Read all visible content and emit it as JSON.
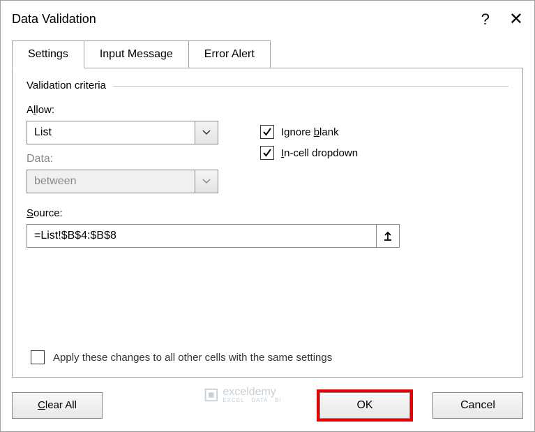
{
  "dialog": {
    "title": "Data Validation",
    "help": "?",
    "close": "✕"
  },
  "tabs": {
    "settings": "Settings",
    "input_message": "Input Message",
    "error_alert": "Error Alert"
  },
  "criteria": {
    "legend": "Validation criteria",
    "allow_label_pre": "A",
    "allow_label_u": "l",
    "allow_label_post": "low:",
    "allow_value": "List",
    "data_label": "Data:",
    "data_value": "between",
    "source_label_u": "S",
    "source_label_post": "ource:",
    "source_value": "=List!$B$4:$B$8"
  },
  "checks": {
    "ignore_blank_pre": "Ignore ",
    "ignore_blank_u": "b",
    "ignore_blank_post": "lank",
    "incell_u": "I",
    "incell_post": "n-cell dropdown"
  },
  "apply": {
    "label": "Apply these changes to all other cells with the same settings"
  },
  "buttons": {
    "clear_u": "C",
    "clear_post": "lear All",
    "ok": "OK",
    "cancel": "Cancel"
  },
  "watermark": {
    "brand": "exceldemy",
    "sub": "EXCEL · DATA · BI"
  }
}
